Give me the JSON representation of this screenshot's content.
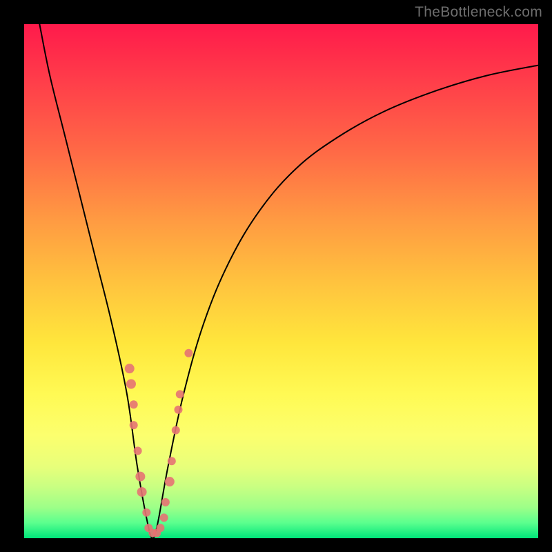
{
  "watermark": "TheBottleneck.com",
  "colors": {
    "page_bg": "#000000",
    "watermark_text": "#6d6d6d",
    "curve_stroke": "#000000",
    "dot_fill": "#e57373",
    "gradient_stops": [
      "#ff1a4b",
      "#ff3a4a",
      "#ff6a46",
      "#ff9a42",
      "#ffc23e",
      "#ffe63c",
      "#fffa54",
      "#fcff6e",
      "#e8ff7a",
      "#c9ff82",
      "#9dff88",
      "#5bff8e",
      "#00e57a"
    ]
  },
  "chart_data": {
    "type": "line",
    "title": "",
    "xlabel": "",
    "ylabel": "",
    "xlim": [
      0,
      100
    ],
    "ylim": [
      0,
      100
    ],
    "grid": false,
    "legend": false,
    "series": [
      {
        "name": "bottleneck-curve",
        "comment": "V-shaped curve; x,y in percent of plot area (0=left/bottom, 100=right/top). Dips to ~0 near x≈25.",
        "x": [
          3,
          5,
          8,
          11,
          14,
          17,
          20,
          22,
          24,
          25,
          26,
          28,
          31,
          35,
          40,
          46,
          53,
          61,
          70,
          80,
          90,
          100
        ],
        "y": [
          100,
          90,
          78,
          66,
          54,
          42,
          28,
          14,
          3,
          0,
          3,
          14,
          28,
          42,
          54,
          64,
          72,
          78,
          83,
          87,
          90,
          92
        ]
      }
    ],
    "dots": {
      "comment": "scatter markers (salmon) overlaid on the curve, concentrated near the valley; x,y in percent of plot area",
      "points": [
        {
          "x": 20.5,
          "y": 33,
          "r": 7
        },
        {
          "x": 20.8,
          "y": 30,
          "r": 7
        },
        {
          "x": 21.3,
          "y": 26,
          "r": 6
        },
        {
          "x": 21.3,
          "y": 22,
          "r": 6
        },
        {
          "x": 22.1,
          "y": 17,
          "r": 6
        },
        {
          "x": 22.6,
          "y": 12,
          "r": 7
        },
        {
          "x": 22.9,
          "y": 9,
          "r": 7
        },
        {
          "x": 23.8,
          "y": 5,
          "r": 6
        },
        {
          "x": 24.2,
          "y": 2,
          "r": 6
        },
        {
          "x": 25.0,
          "y": 1,
          "r": 6
        },
        {
          "x": 25.8,
          "y": 1,
          "r": 6
        },
        {
          "x": 26.5,
          "y": 2,
          "r": 6
        },
        {
          "x": 27.2,
          "y": 4,
          "r": 6
        },
        {
          "x": 27.5,
          "y": 7,
          "r": 6
        },
        {
          "x": 28.3,
          "y": 11,
          "r": 7
        },
        {
          "x": 28.7,
          "y": 15,
          "r": 6
        },
        {
          "x": 29.5,
          "y": 21,
          "r": 6
        },
        {
          "x": 30.0,
          "y": 25,
          "r": 6
        },
        {
          "x": 30.3,
          "y": 28,
          "r": 6
        },
        {
          "x": 32.0,
          "y": 36,
          "r": 6
        }
      ]
    }
  }
}
